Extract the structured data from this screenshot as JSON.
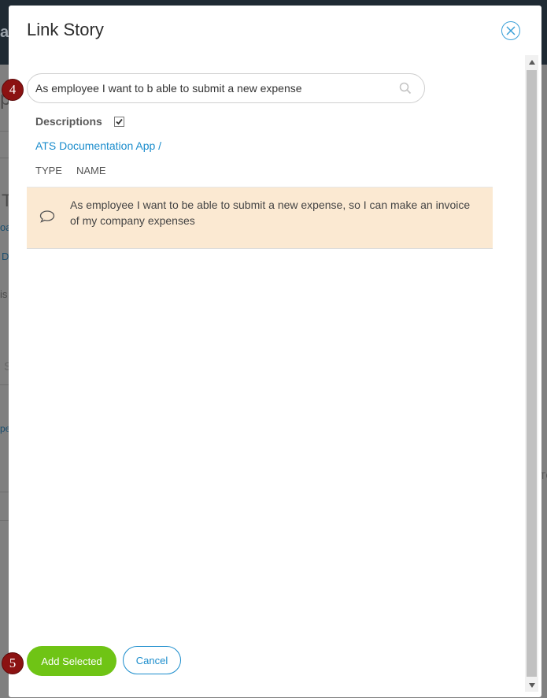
{
  "modal": {
    "title": "Link Story",
    "search": {
      "value": "As employee I want to b able to submit a new expense"
    },
    "descriptions_label": "Descriptions",
    "descriptions_checked": true,
    "breadcrumb": "ATS Documentation App /",
    "columns": {
      "type": "TYPE",
      "name": "NAME"
    },
    "results": [
      {
        "icon": "comment-icon",
        "text": "As employee I want to be able to submit a new expense, so I can make an invoice of my company expenses"
      }
    ],
    "buttons": {
      "add_selected": "Add Selected",
      "cancel": "Cancel"
    }
  },
  "markers": {
    "search": "4",
    "add_selected": "5"
  },
  "background_fragments": {
    "topbar": "ar",
    "letter_p": "p",
    "letter_t": "T",
    "link_oa": "oa",
    "link_d": "D",
    "text_is": "is",
    "text_s": "S",
    "text_pe": "pe",
    "text_tc": "TC"
  },
  "colors": {
    "accent_blue": "#1a8ccc",
    "primary_green": "#6fc415",
    "selected_row": "#fbe9d2",
    "marker": "#8b1212"
  }
}
